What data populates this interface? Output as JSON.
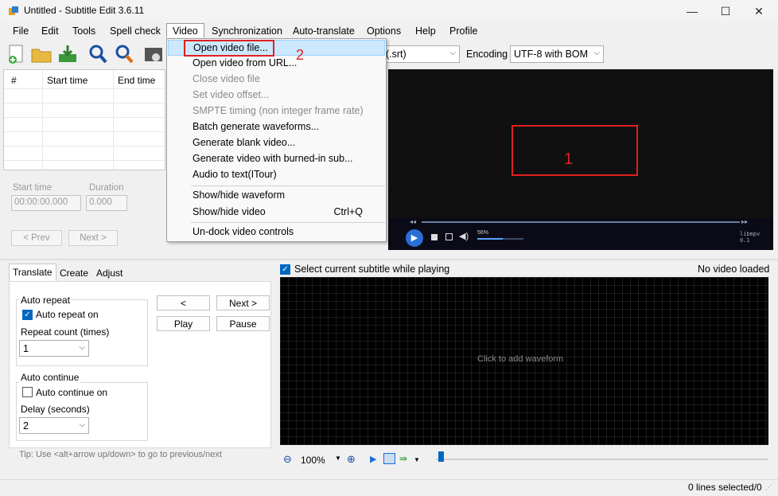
{
  "window": {
    "title": "Untitled - Subtitle Edit 3.6.11",
    "minimize": "—",
    "maximize": "☐",
    "close": "✕"
  },
  "menubar": {
    "items": [
      "File",
      "Edit",
      "Tools",
      "Spell check",
      "Video",
      "Synchronization",
      "Auto-translate",
      "Options",
      "Help",
      "Profile"
    ],
    "active": "Video"
  },
  "toolbar": {
    "format_value": "(.srt)",
    "encoding_label": "Encoding",
    "encoding_value": "UTF-8 with BOM"
  },
  "subtitle_list": {
    "columns": [
      "#",
      "Start time",
      "End time"
    ]
  },
  "edit": {
    "start_time_label": "Start time",
    "start_time_value": "00:00:00.000",
    "duration_label": "Duration",
    "duration_value": "0.000",
    "prev_button": "< Prev",
    "next_button": "Next >"
  },
  "video_menu": {
    "items": [
      {
        "label": "Open video file...",
        "enabled": true,
        "highlighted": true
      },
      {
        "label": "Open video from URL...",
        "enabled": true
      },
      {
        "label": "Close video file",
        "enabled": false
      },
      {
        "label": "Set video offset...",
        "enabled": false
      },
      {
        "label": "SMPTE timing (non integer frame rate)",
        "enabled": false
      },
      {
        "label": "Batch generate waveforms...",
        "enabled": true
      },
      {
        "label": "Generate blank video...",
        "enabled": true
      },
      {
        "label": "Generate video with burned-in sub...",
        "enabled": true
      },
      {
        "label": "Audio to text(ITour)",
        "enabled": true
      },
      {
        "label": "Show/hide waveform",
        "enabled": true
      },
      {
        "label": "Show/hide video",
        "enabled": true,
        "shortcut": "Ctrl+Q"
      },
      {
        "label": "Un-dock video controls",
        "enabled": true
      }
    ]
  },
  "annotations": {
    "marker_1": "1",
    "marker_2": "2",
    "color": "#e02020"
  },
  "video_player": {
    "volume": "56%",
    "renderer": "libmpv 0.1"
  },
  "translate_panel": {
    "tabs": [
      "Translate",
      "Create",
      "Adjust"
    ],
    "active_tab": "Translate",
    "auto_repeat_title": "Auto repeat",
    "auto_repeat_on_label": "Auto repeat on",
    "auto_repeat_on_checked": true,
    "repeat_count_label": "Repeat count (times)",
    "repeat_count_value": "1",
    "auto_continue_title": "Auto continue",
    "auto_continue_on_label": "Auto continue on",
    "auto_continue_on_checked": false,
    "delay_label": "Delay (seconds)",
    "delay_value": "2",
    "prev_btn": "<",
    "next_btn": "Next >",
    "play_btn": "Play",
    "pause_btn": "Pause",
    "tip": "Tip: Use <alt+arrow up/down> to go to previous/next"
  },
  "waveform": {
    "select_current_label": "Select current subtitle while playing",
    "select_current_checked": true,
    "no_video_text": "No video loaded",
    "click_to_add": "Click to add waveform",
    "zoom_value": "100%"
  },
  "status": {
    "lines_selected": "0 lines selected/0"
  },
  "colors": {
    "accent": "#0067c0",
    "highlight": "#cce8ff",
    "video_bg": "#101010"
  }
}
